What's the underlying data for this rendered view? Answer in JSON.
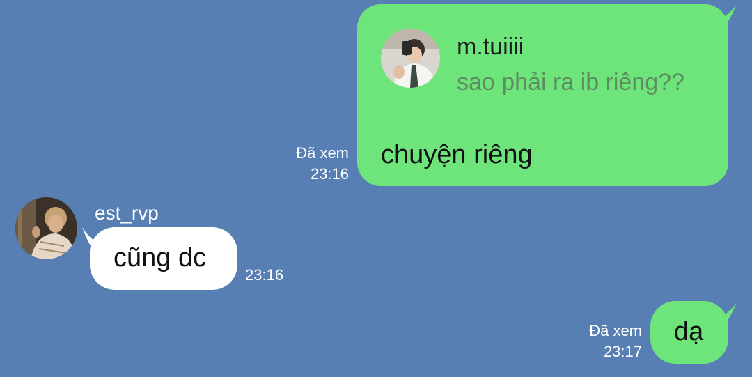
{
  "messages": {
    "reply": {
      "quoted_sender": "m.tuiiii",
      "quoted_text": "sao phải ra ib riêng??",
      "text": "chuyện riêng",
      "status": "Đã xem",
      "time": "23:16"
    },
    "incoming": {
      "sender": "est_rvp",
      "text": "cũng dc",
      "time": "23:16"
    },
    "outgoing": {
      "text": "dạ",
      "status": "Đã xem",
      "time": "23:17"
    }
  },
  "colors": {
    "background": "#577fb3",
    "outgoing_bubble": "#6ee57b",
    "incoming_bubble": "#ffffff"
  }
}
